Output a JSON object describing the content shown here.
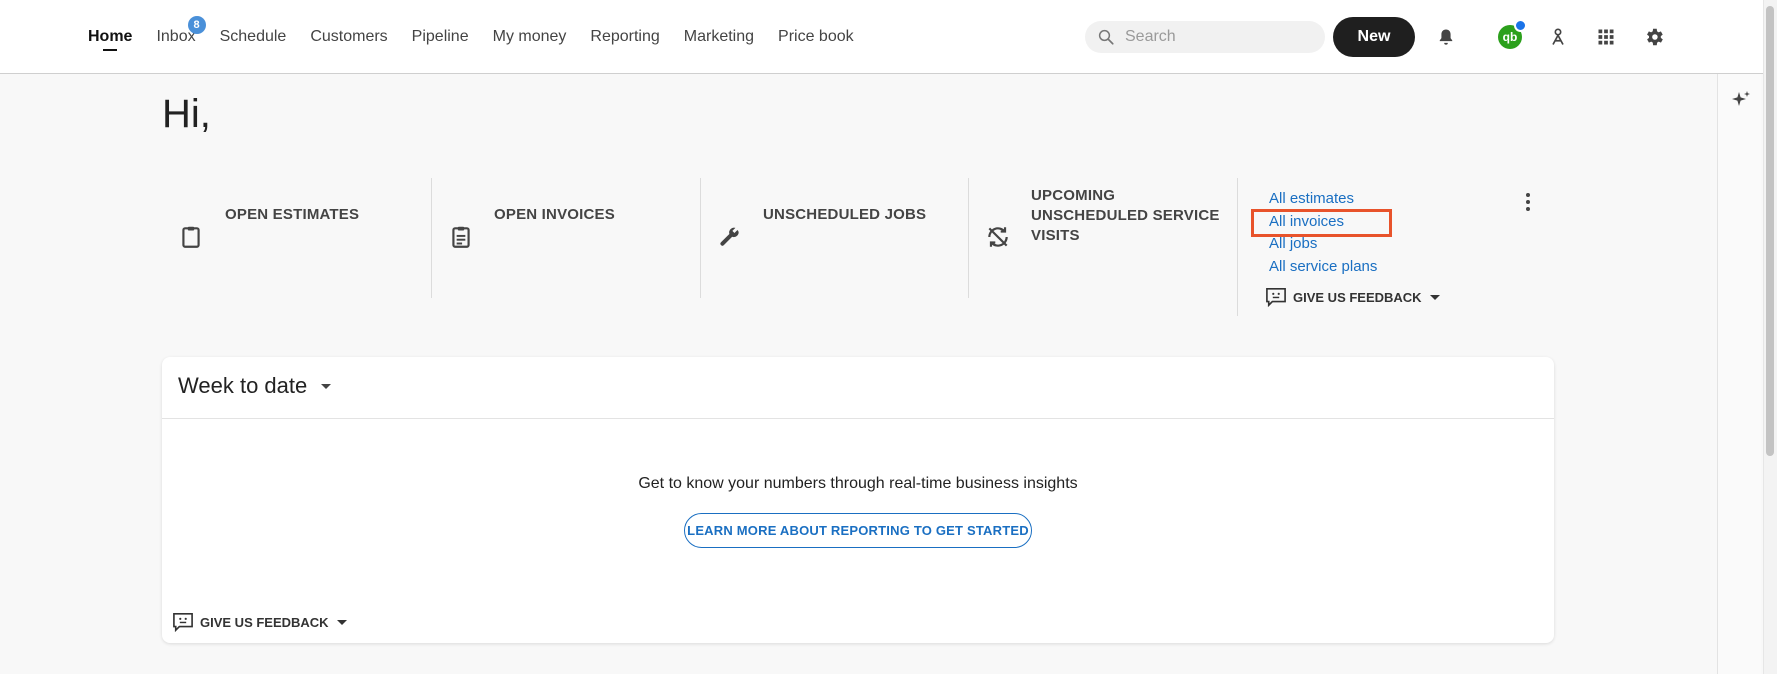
{
  "nav": {
    "items": [
      {
        "label": "Home",
        "active": true
      },
      {
        "label": "Inbox",
        "badge": "8"
      },
      {
        "label": "Schedule"
      },
      {
        "label": "Customers"
      },
      {
        "label": "Pipeline"
      },
      {
        "label": "My money"
      },
      {
        "label": "Reporting"
      },
      {
        "label": "Marketing"
      },
      {
        "label": "Price book"
      }
    ],
    "search_placeholder": "Search",
    "new_label": "New",
    "qb_label": "qb"
  },
  "greeting": "Hi,",
  "stats": [
    {
      "label": "OPEN ESTIMATES",
      "icon": "clipboard-icon"
    },
    {
      "label": "OPEN INVOICES",
      "icon": "invoice-icon"
    },
    {
      "label": "UNSCHEDULED JOBS",
      "icon": "wrench-icon"
    },
    {
      "label": "UPCOMING UNSCHEDULED SERVICE VISITS",
      "icon": "sync-icon"
    }
  ],
  "quick_links": [
    "All estimates",
    "All invoices",
    "All jobs",
    "All service plans"
  ],
  "feedback_label": "GIVE US FEEDBACK",
  "card": {
    "period": "Week to date",
    "insight": "Get to know your numbers through real-time business insights",
    "learn_button": "LEARN MORE ABOUT REPORTING TO GET STARTED",
    "feedback_label": "GIVE US FEEDBACK"
  },
  "colors": {
    "accent_link": "#1a6fc2",
    "highlight": "#e8532b",
    "badge": "#4a90d9",
    "qb_green": "#2ca01c"
  }
}
